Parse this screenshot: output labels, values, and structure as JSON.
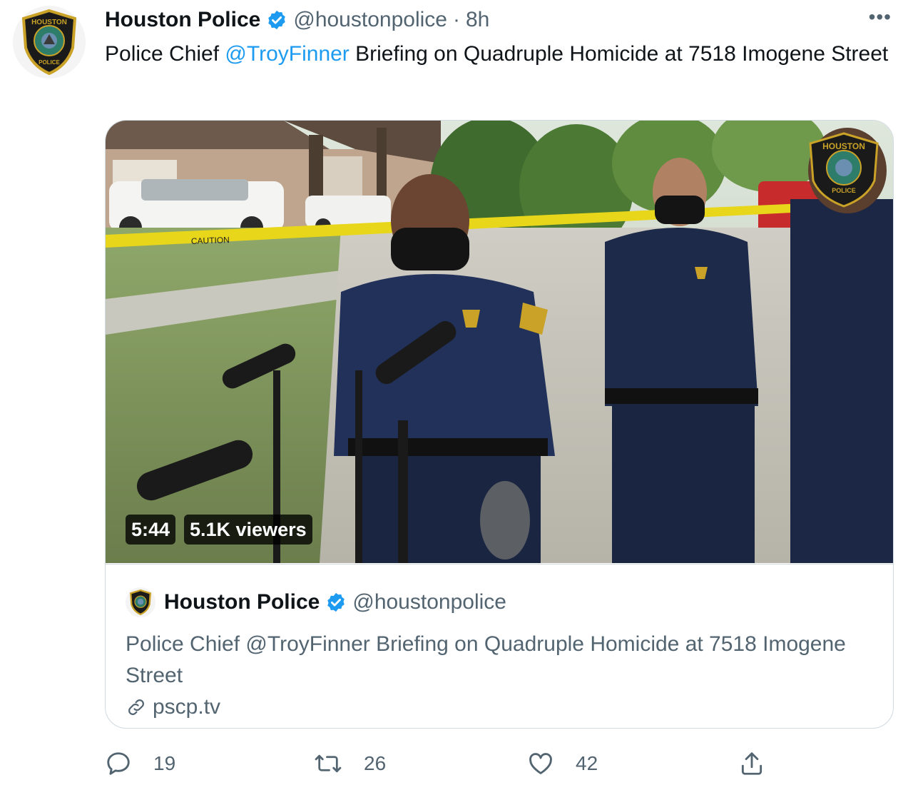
{
  "tweet": {
    "author_name": "Houston Police",
    "author_handle": "@houstonpolice",
    "separator": "·",
    "time": "8h",
    "more_icon": "more-horizontal-icon",
    "text_before": "Police Chief ",
    "mention": "@TroyFinner",
    "text_after": " Briefing on Quadruple Homicide at 7518 Imogene Street"
  },
  "badge": {
    "top_text": "HOUSTON",
    "bottom_text": "POLICE",
    "colors": {
      "gold": "#c9a227",
      "dark": "#1a1a1a",
      "teal": "#2e7d6b"
    }
  },
  "video": {
    "duration": "5:44",
    "viewers": "5.1K viewers",
    "overlay_badge_top": "HOUSTON",
    "overlay_badge_bottom": "POLICE",
    "tape_text": "CAUTION"
  },
  "quote": {
    "author_name": "Houston Police",
    "author_handle": "@houstonpolice",
    "text": "Police Chief @TroyFinner Briefing on Quadruple Homicide at 7518 Imogene Street",
    "link": "pscp.tv"
  },
  "actions": {
    "replies": "19",
    "retweets": "26",
    "likes": "42"
  },
  "colors": {
    "link_blue": "#1d9bf0",
    "secondary_text": "#536471",
    "border": "#cfd9de",
    "verified": "#1d9bf0"
  }
}
